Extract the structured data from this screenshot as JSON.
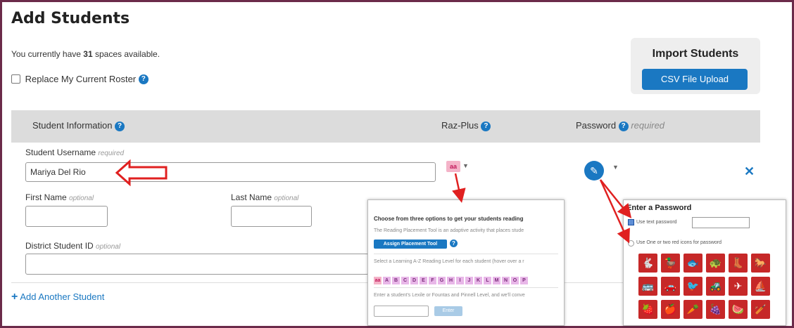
{
  "page": {
    "title": "Add Students"
  },
  "spaces": {
    "prefix": "You currently have ",
    "count": "31",
    "suffix": " spaces available."
  },
  "roster": {
    "replace_label": "Replace My Current Roster"
  },
  "import": {
    "title": "Import Students",
    "csv_button": "CSV File Upload"
  },
  "table_header": {
    "student_info": "Student Information",
    "raz_plus": "Raz-Plus",
    "password": "Password",
    "password_required": "required"
  },
  "form": {
    "username_label": "Student Username",
    "username_hint": "required",
    "username_value": "Mariya Del Rio",
    "first_name_label": "First Name",
    "first_name_hint": "optional",
    "last_name_label": "Last Name",
    "last_name_hint": "optional",
    "district_id_label": "District Student ID",
    "district_id_hint": "optional"
  },
  "level_badge": "aa",
  "add_another": "Add Another Student",
  "level_popup": {
    "title": "Choose from three options to get your students reading",
    "line1": "The Reading Placement Tool is an adaptive activity that places stude",
    "assign_button": "Assign Placement Tool",
    "line2": "Select a Learning A-Z Reading Level for each student (hover over a r",
    "levels": [
      "aa",
      "A",
      "B",
      "C",
      "D",
      "E",
      "F",
      "G",
      "H",
      "I",
      "J",
      "K",
      "L",
      "M",
      "N",
      "O",
      "P"
    ],
    "line3": "Enter a student's Lexile or Fountas and Pinnell Level, and we'll conve",
    "enter_button": "Enter"
  },
  "password_popup": {
    "title": "Enter a Password",
    "option_text": "Use text password",
    "option_icons": "Use One or two red icons for password",
    "icons": [
      "rabbit",
      "duck",
      "fish",
      "turtle",
      "boot",
      "horse",
      "bus",
      "car",
      "bird",
      "tractor",
      "plane",
      "sailboat",
      "strawberry",
      "apple",
      "carrot",
      "grapes",
      "watermelon",
      "baseball-bat"
    ]
  },
  "colors": {
    "accent": "#1a78c2",
    "header_bg": "#dcdcdc",
    "frame": "#6b2a4a",
    "annotation": "#e02020",
    "icon_red": "#c62828"
  }
}
